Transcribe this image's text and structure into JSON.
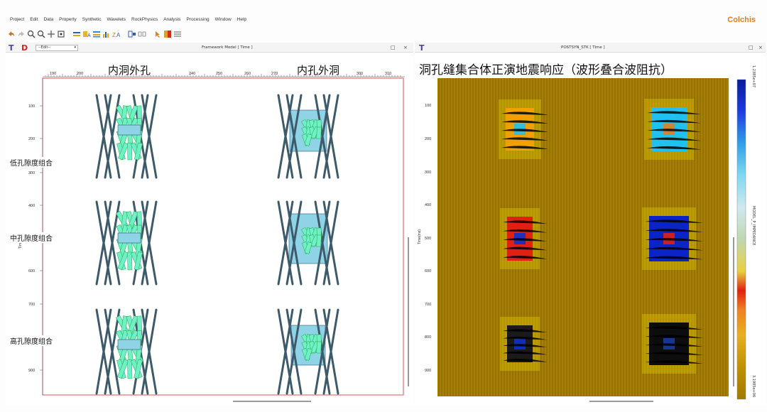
{
  "menu": {
    "items": [
      "Project",
      "Edit",
      "Data",
      "Property",
      "Synthetic",
      "Wavelets",
      "RockPhysics",
      "Analysis",
      "Processing",
      "Window",
      "Help"
    ],
    "brand": "Colchis"
  },
  "left_panel": {
    "tab_t": "T",
    "tab_d": "D",
    "edit_select": "--Edit--",
    "title": "Framework Model [ Time ]",
    "restore": "□",
    "close": "×",
    "caption_left": "内洞外孔",
    "caption_right": "内孔外洞",
    "row_labels": [
      "低孔隙度组合",
      "中孔隙度组合",
      "高孔隙度组合"
    ],
    "x_ticks": [
      "190",
      "200",
      "240",
      "250",
      "260",
      "270",
      "300",
      "310"
    ],
    "y_ticks": [
      "100",
      "200",
      "300",
      "400",
      "600",
      "700",
      "800",
      "900"
    ],
    "y_axis_label": "Tim"
  },
  "right_panel": {
    "tab_t": "T",
    "title": "POSTSYN_STK [ Time ]",
    "restore": "□",
    "close": "×",
    "figure_title": "洞孔缝集合体正演地震响应（波形叠合波阻抗）",
    "y_axis_label": "Time(ms)",
    "y_ticks": [
      "100",
      "200",
      "300",
      "400",
      "500",
      "600",
      "700",
      "800",
      "900"
    ],
    "colorbar_label": "MODEL_P_IMPEDANCE",
    "colorbar_top": "1.2385e+07",
    "colorbar_bottom": "3.1985e+06"
  },
  "colors": {
    "frame_red": "#d9534f",
    "vug_cyan": "#6ff0c6",
    "box_blue": "#8fd3e6",
    "seismic_bg": "#a88000",
    "impedance_blue": "#0a24c8",
    "impedance_red": "#e02010"
  }
}
